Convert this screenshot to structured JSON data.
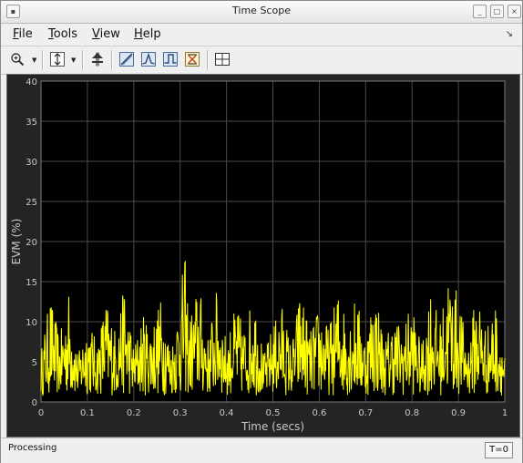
{
  "window": {
    "title": "Time Scope"
  },
  "menu": {
    "items": [
      {
        "label": "File",
        "mnemonic": "F",
        "rest": "ile"
      },
      {
        "label": "Tools",
        "mnemonic": "T",
        "rest": "ools"
      },
      {
        "label": "View",
        "mnemonic": "V",
        "rest": "iew"
      },
      {
        "label": "Help",
        "mnemonic": "H",
        "rest": "elp"
      }
    ]
  },
  "toolbar": {
    "tools": [
      "zoom-in-icon",
      "scale-axes-icon",
      "stepping-icon",
      "data-cursor-icon",
      "peak-finder-icon",
      "bilevel-measurements-icon",
      "signal-statistics-icon",
      "layout-icon"
    ]
  },
  "colors": {
    "plot_background": "#000000",
    "frame_background": "#242424",
    "signal": "#ffff00",
    "grid": "#4a4a4a",
    "tick_text": "#c8c8c8"
  },
  "chart_data": {
    "type": "line",
    "title": "",
    "xlabel": "Time (secs)",
    "ylabel": "EVM (%)",
    "xlim": [
      0,
      1
    ],
    "ylim": [
      0,
      40
    ],
    "xticks": [
      "0",
      "0.1",
      "0.2",
      "0.3",
      "0.4",
      "0.5",
      "0.6",
      "0.7",
      "0.8",
      "0.9",
      "1"
    ],
    "yticks": [
      "0",
      "5",
      "10",
      "15",
      "20",
      "25",
      "30",
      "35",
      "40"
    ],
    "grid": true,
    "series": [
      {
        "color": "#ffff00",
        "x": [
          0.0,
          0.02,
          0.04,
          0.06,
          0.08,
          0.1,
          0.12,
          0.14,
          0.16,
          0.18,
          0.2,
          0.22,
          0.24,
          0.26,
          0.28,
          0.3,
          0.31,
          0.32,
          0.34,
          0.36,
          0.38,
          0.4,
          0.42,
          0.44,
          0.46,
          0.48,
          0.5,
          0.52,
          0.54,
          0.56,
          0.58,
          0.6,
          0.62,
          0.64,
          0.66,
          0.68,
          0.7,
          0.72,
          0.74,
          0.76,
          0.78,
          0.8,
          0.82,
          0.84,
          0.86,
          0.88,
          0.9,
          0.92,
          0.94,
          0.96,
          0.98,
          1.0
        ],
        "y": [
          5.5,
          11.5,
          7.0,
          12.0,
          5.0,
          9.5,
          6.5,
          11.0,
          8.0,
          12.5,
          6.0,
          9.5,
          8.5,
          11.5,
          6.0,
          12.0,
          16.0,
          9.0,
          13.0,
          7.0,
          12.5,
          6.5,
          10.5,
          8.0,
          12.5,
          5.0,
          8.5,
          10.5,
          6.0,
          12.5,
          7.5,
          10.5,
          8.0,
          12.0,
          9.5,
          11.5,
          7.0,
          13.0,
          6.5,
          9.5,
          8.0,
          11.0,
          6.0,
          12.5,
          8.5,
          14.5,
          11.5,
          6.0,
          12.5,
          8.0,
          10.5,
          5.0
        ]
      }
    ]
  },
  "status": {
    "text": "Processing",
    "time": "T=0"
  }
}
